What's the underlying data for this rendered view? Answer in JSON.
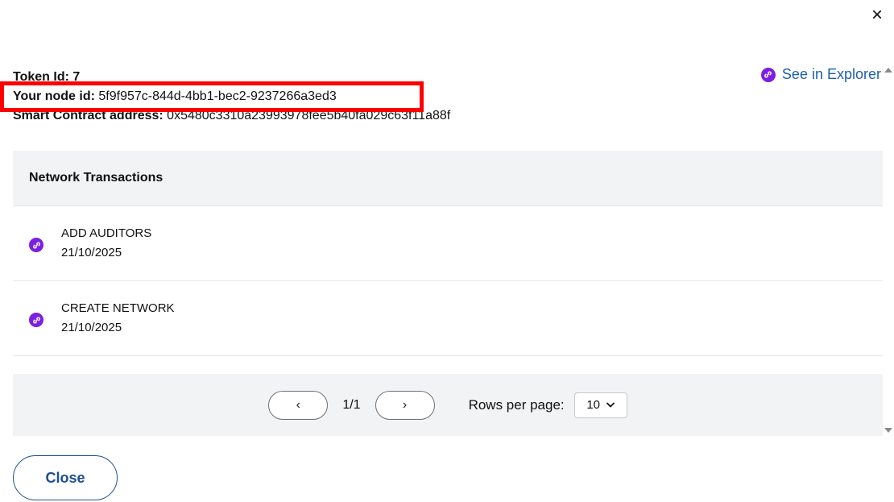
{
  "modal": {
    "close_icon": "×"
  },
  "token": {
    "token_label": "Token Id:",
    "token_value": "7",
    "node_label": "Your node id:",
    "node_value": "5f9f957c-844d-4bb1-bec2-9237266a3ed3",
    "contract_label": "Smart Contract address:",
    "contract_value": "0x5480c3310a23993978fee5b40fa029c63f11a88f"
  },
  "explorer": {
    "label": "See in Explorer",
    "icon": "link-icon"
  },
  "table": {
    "header": "Network Transactions",
    "rows": [
      {
        "title": "ADD AUDITORS",
        "date": "21/10/2025",
        "icon": "link-icon"
      },
      {
        "title": "CREATE NETWORK",
        "date": "21/10/2025",
        "icon": "link-icon"
      }
    ]
  },
  "pagination": {
    "prev": "‹",
    "next": "›",
    "page": "1/1",
    "rows_label": "Rows per page:",
    "rows_value": "10"
  },
  "footer": {
    "close_label": "Close"
  },
  "colors": {
    "link_badge": "#7c1fe0",
    "link_text": "#1f5fa8",
    "highlight": "#ff0000",
    "button_border": "#1d4f8f"
  }
}
